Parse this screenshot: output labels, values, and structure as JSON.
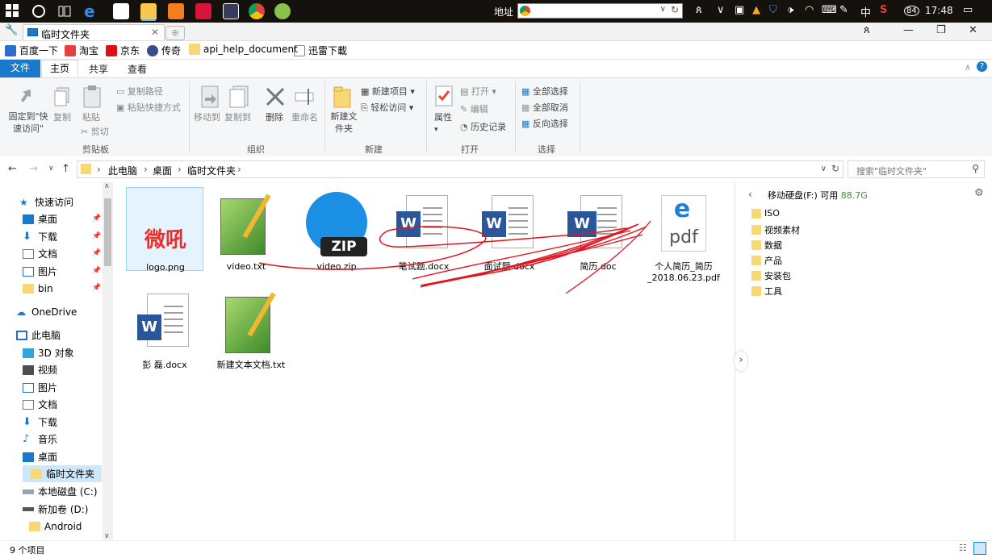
{
  "taskbar": {
    "address_label": "地址",
    "clock": "17:48",
    "tray_ime_ch": "中",
    "tray_badge": "84"
  },
  "browser": {
    "tab_title": "临时文件夹",
    "bookmarks": [
      "百度一下",
      "淘宝",
      "京东",
      "传奇",
      "api_help_document",
      "迅雷下載"
    ]
  },
  "ribbon": {
    "tabs": {
      "file": "文件",
      "home": "主页",
      "share": "共享",
      "view": "查看"
    },
    "clipboard": {
      "pin": "固定到\"快速访问\"",
      "copy": "复制",
      "paste": "粘贴",
      "copy_path": "复制路径",
      "paste_shortcut": "粘贴快捷方式",
      "cut": "剪切",
      "group": "剪贴板"
    },
    "organize": {
      "move_to": "移动到",
      "copy_to": "复制到",
      "delete": "删除",
      "rename": "重命名",
      "group": "组织"
    },
    "new": {
      "new_folder": "新建文件夹",
      "new_item": "新建项目",
      "easy_access": "轻松访问",
      "group": "新建"
    },
    "open": {
      "properties": "属性",
      "open": "打开",
      "edit": "编辑",
      "history": "历史记录",
      "group": "打开"
    },
    "select": {
      "select_all": "全部选择",
      "select_none": "全部取消",
      "invert": "反向选择",
      "group": "选择"
    }
  },
  "nav": {
    "breadcrumbs": [
      "此电脑",
      "桌面",
      "临时文件夹"
    ],
    "search_placeholder": "搜索\"临时文件夹\""
  },
  "sidebar": {
    "items": [
      {
        "label": "快速访问"
      },
      {
        "label": "桌面"
      },
      {
        "label": "下载"
      },
      {
        "label": "文档"
      },
      {
        "label": "图片"
      },
      {
        "label": "bin"
      },
      {
        "label": "OneDrive"
      },
      {
        "label": "此电脑"
      },
      {
        "label": "3D 对象"
      },
      {
        "label": "视频"
      },
      {
        "label": "图片"
      },
      {
        "label": "文档"
      },
      {
        "label": "下载"
      },
      {
        "label": "音乐"
      },
      {
        "label": "桌面"
      },
      {
        "label": "临时文件夹"
      },
      {
        "label": "本地磁盘 (C:)"
      },
      {
        "label": "新加卷 (D:)"
      },
      {
        "label": "Android"
      }
    ]
  },
  "files": [
    {
      "name": "logo.png",
      "logo_text": "微吼"
    },
    {
      "name": "video.txt"
    },
    {
      "name": "video.zip",
      "badge": "ZIP"
    },
    {
      "name": "笔试题.docx",
      "badge": "W"
    },
    {
      "name": "面试题.docx",
      "badge": "W"
    },
    {
      "name": "简历.doc",
      "badge": "W"
    },
    {
      "name": "个人简历_简历_2018.06.23.pdf",
      "badge": "pdf"
    },
    {
      "name": "彭 磊.docx",
      "badge": "W"
    },
    {
      "name": "新建文本文档.txt"
    }
  ],
  "preview": {
    "drive": "移动硬盘(F:)",
    "free_label": "可用",
    "free_value": "88.7G",
    "folders": [
      "ISO",
      "视频素材",
      "数据",
      "产品",
      "安装包",
      "工具"
    ]
  },
  "status": {
    "count": "9 个项目"
  },
  "colors": {
    "accent": "#1979ca",
    "folder": "#f8d775",
    "word": "#2b579a",
    "scribble": "#e0141e"
  }
}
